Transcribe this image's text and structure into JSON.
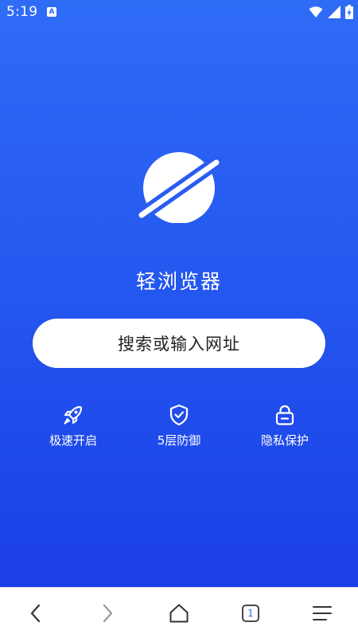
{
  "status_bar": {
    "time": "5:19",
    "notification_icon": "A",
    "icons": [
      "wifi-icon",
      "signal-icon",
      "battery-charging-icon"
    ]
  },
  "app": {
    "title": "轻浏览器",
    "logo": "planet-logo"
  },
  "search": {
    "placeholder": "搜索或输入网址"
  },
  "features": [
    {
      "icon": "rocket-icon",
      "label": "极速开启"
    },
    {
      "icon": "shield-check-icon",
      "label": "5层防御"
    },
    {
      "icon": "lock-icon",
      "label": "隐私保护"
    }
  ],
  "bottom_nav": {
    "tab_count": "1",
    "items": [
      "back-icon",
      "forward-icon",
      "home-icon",
      "tabs-icon",
      "menu-icon"
    ]
  },
  "colors": {
    "background_top": "#2f6cf6",
    "background_bottom": "#1b3fe6",
    "accent": "#2f6cf6"
  }
}
